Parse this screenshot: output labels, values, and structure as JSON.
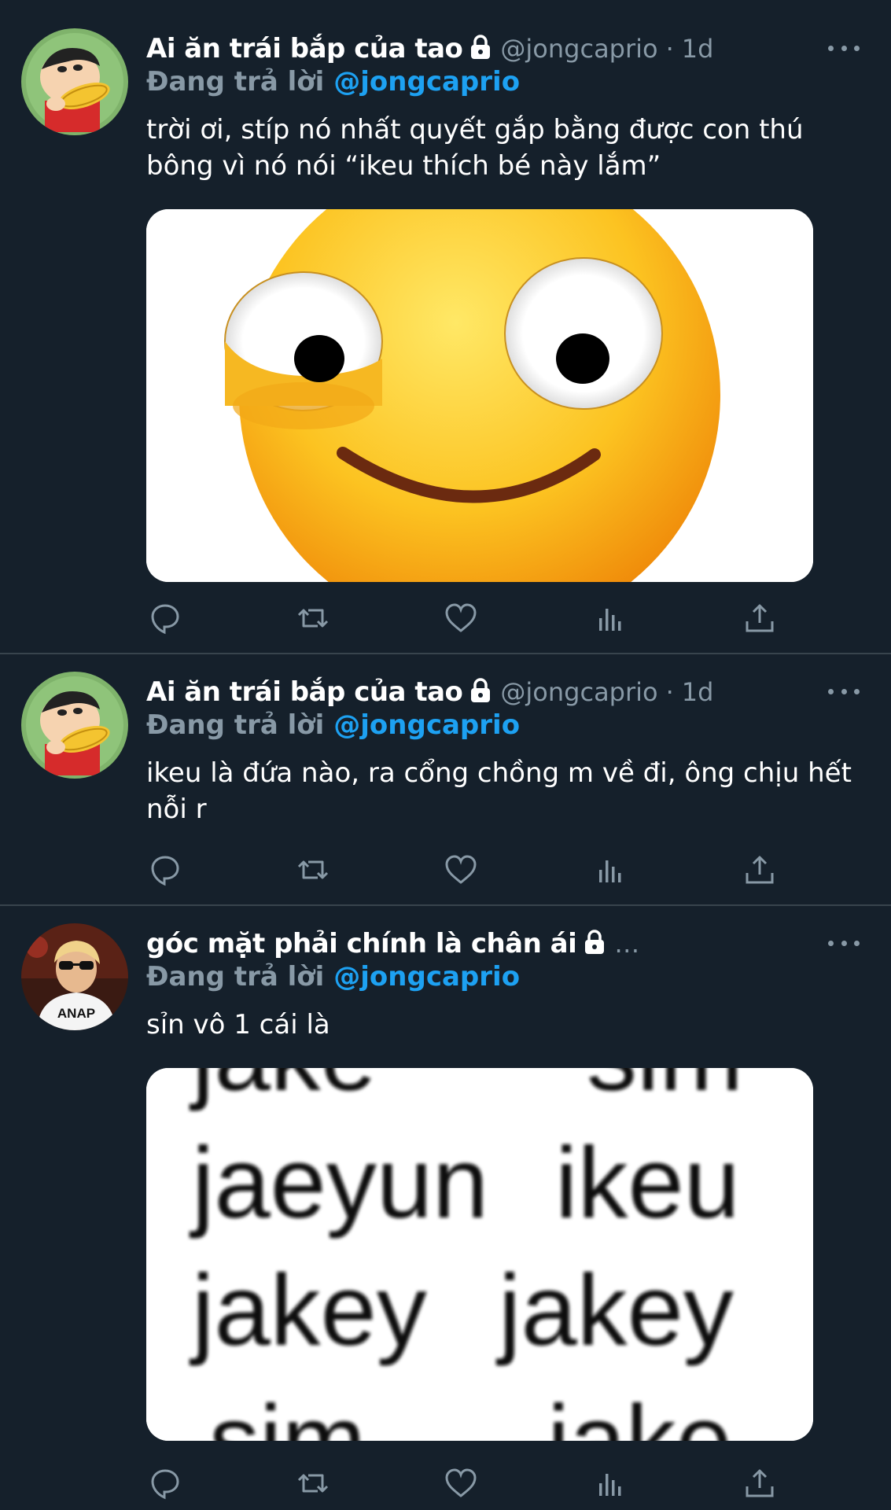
{
  "tweets": [
    {
      "name": "Ai ăn trái bắp của tao",
      "handle": "@jongcaprio",
      "dot": "·",
      "time": "1d",
      "reply_prefix": "Đang trả lời",
      "reply_to": "@jongcaprio",
      "text": "trời ơi, stíp nó nhất quyết gắp bằng được con thú bông vì nó nói “ikeu thích bé này lắm”",
      "media": "emoji-image"
    },
    {
      "name": "Ai ăn trái bắp của tao",
      "handle": "@jongcaprio",
      "dot": "·",
      "time": "1d",
      "reply_prefix": "Đang trả lời",
      "reply_to": "@jongcaprio",
      "text": "ikeu là đứa nào, ra cổng chồng m về đi, ông chịu hết nỗi r"
    },
    {
      "name": "góc mặt phải chính là chân ái",
      "ellipsis": "…",
      "reply_prefix": "Đang trả lời",
      "reply_to": "@jongcaprio",
      "text": "sỉn vô 1 cái là",
      "media_text": {
        "top_left": "jake",
        "top_right": "sim",
        "row1_left": "jaeyun",
        "row1_right": "ikeu",
        "row2_left": "jakey",
        "row2_right": "jakey",
        "bottom_left": "sim",
        "bottom_right": "jake"
      },
      "avatar_shirt_text": "ANAP"
    }
  ],
  "icons": [
    "reply-icon",
    "retweet-icon",
    "like-icon",
    "analytics-icon",
    "share-icon",
    "lock-icon",
    "more-icon"
  ],
  "colors": {
    "background": "#15202b",
    "muted": "#8899a6",
    "accent": "#1da1f2",
    "divider": "#38444d"
  }
}
